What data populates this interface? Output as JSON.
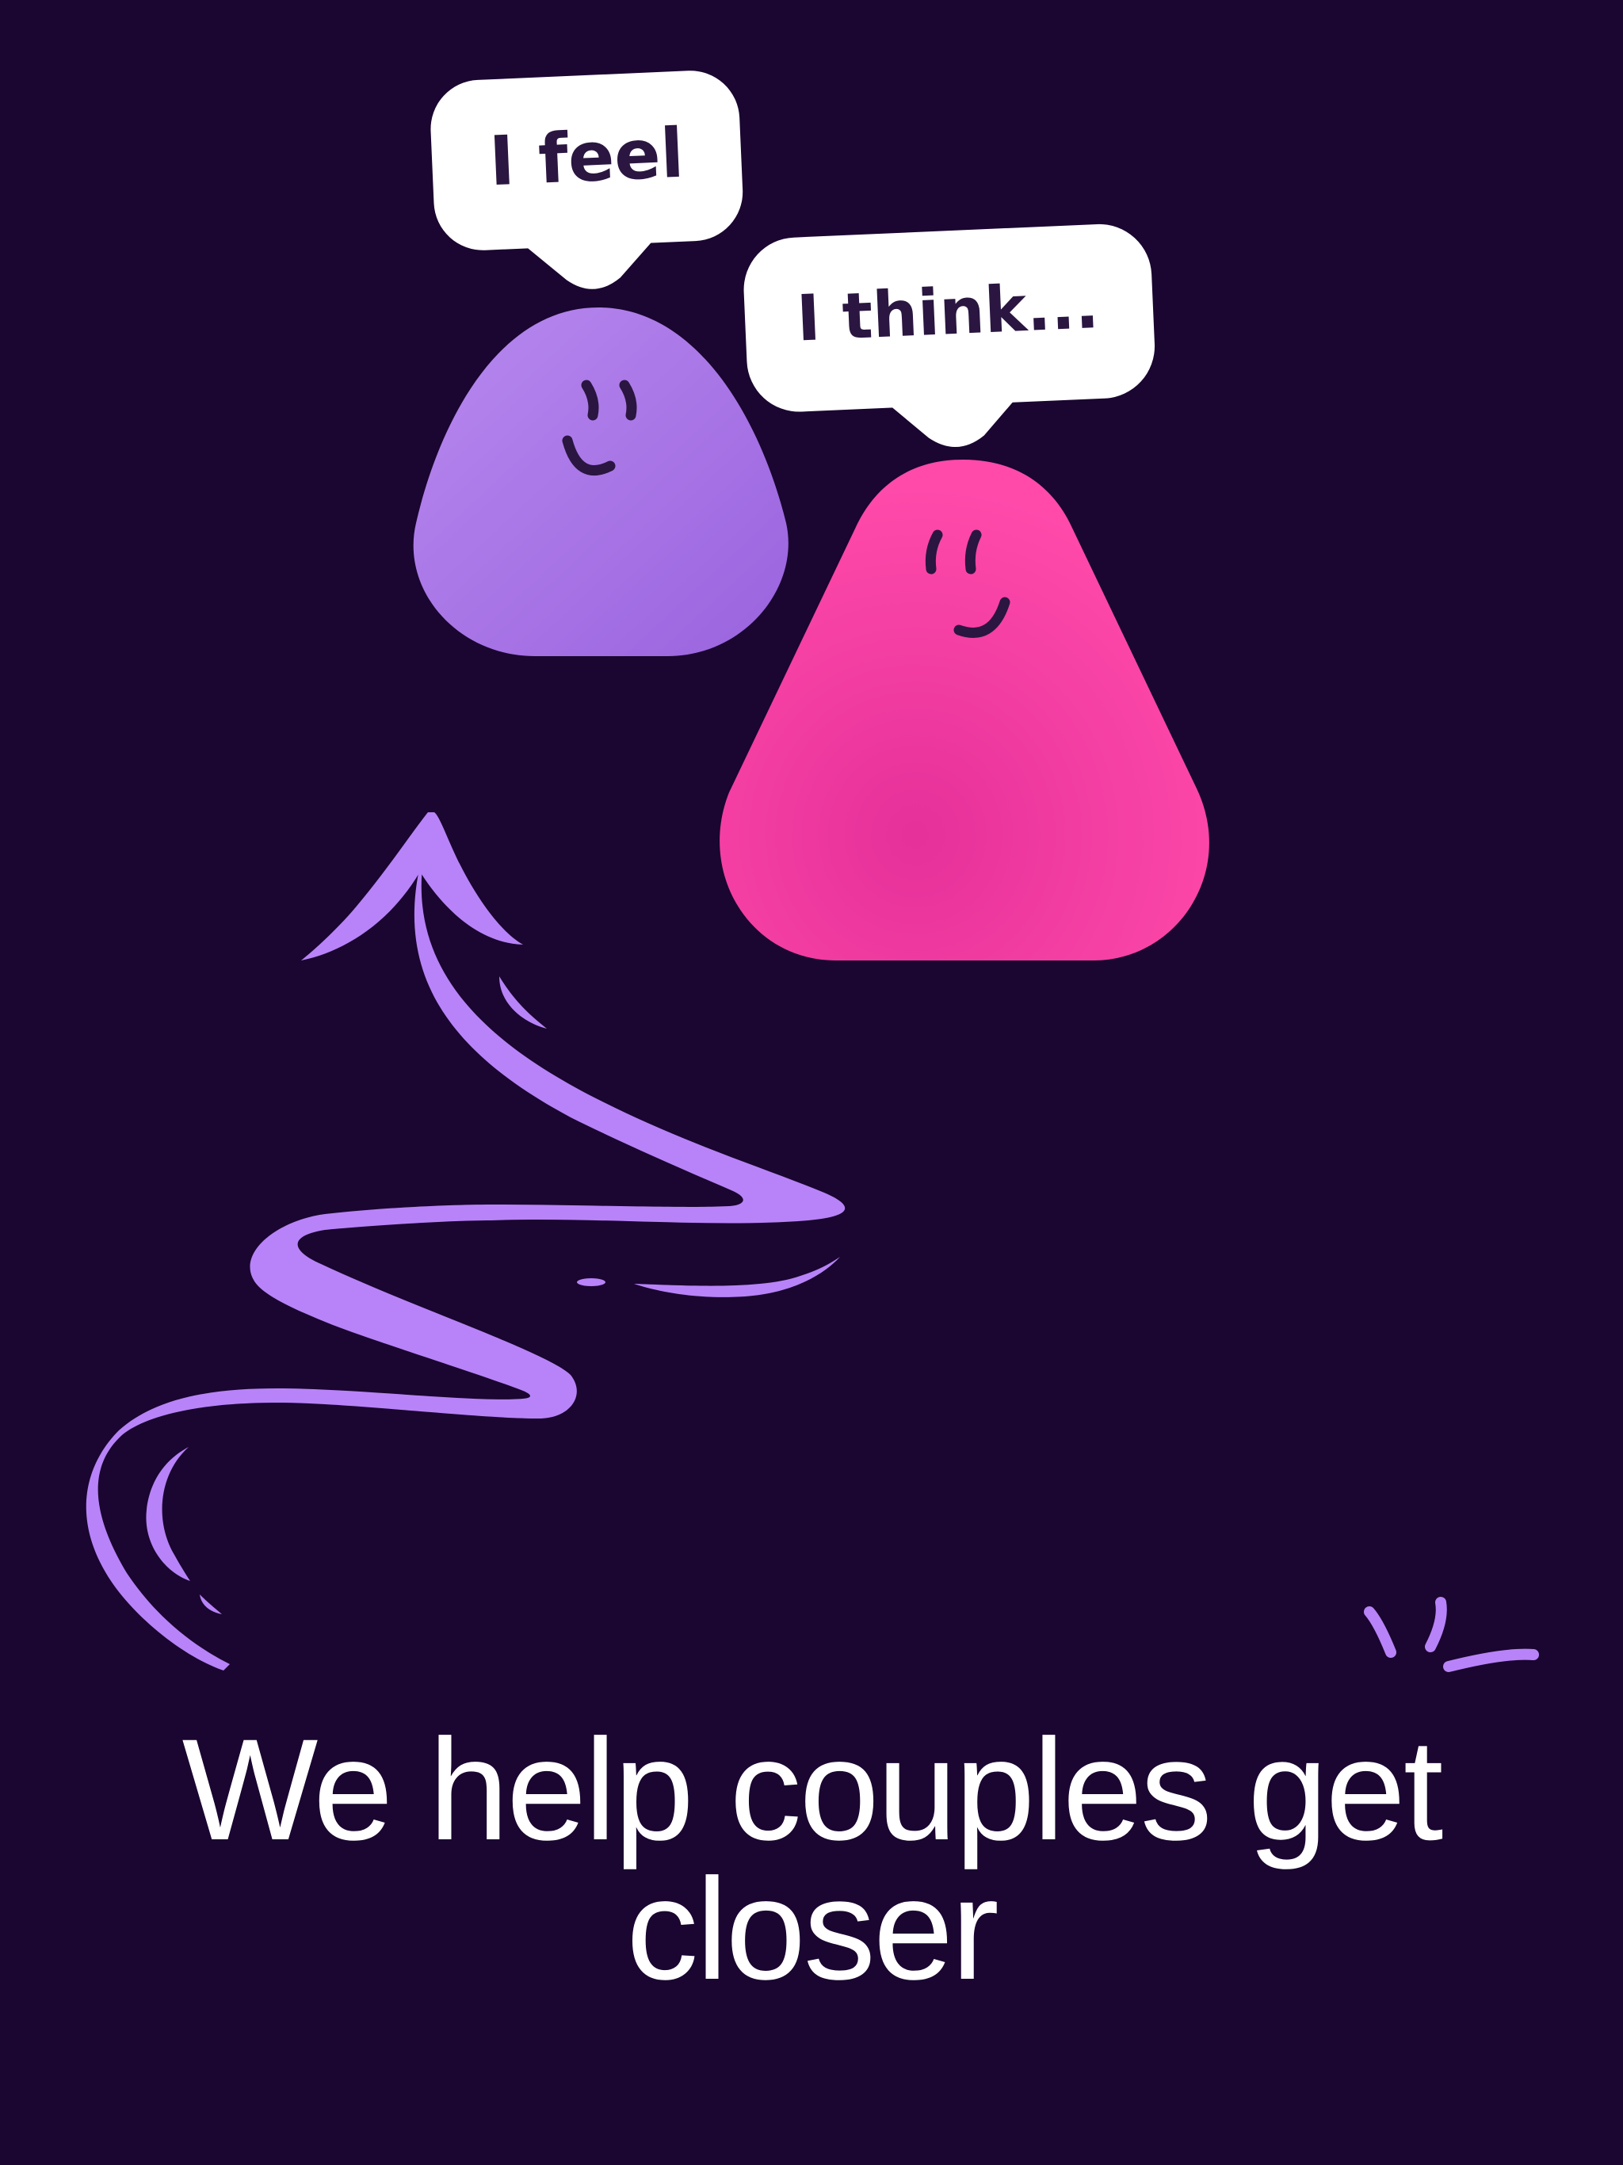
{
  "bubbles": {
    "feel": {
      "text": "I feel"
    },
    "think": {
      "text": "I think..."
    }
  },
  "headline": {
    "text": "We help couples get closer"
  },
  "colors": {
    "background": "#1a0630",
    "purple_character": "#a875e6",
    "pink_character": "#f242a0",
    "arrow": "#b883f8",
    "bubble": "#ffffff",
    "bubble_text": "#2a1640",
    "headline_text": "#ffffff"
  }
}
